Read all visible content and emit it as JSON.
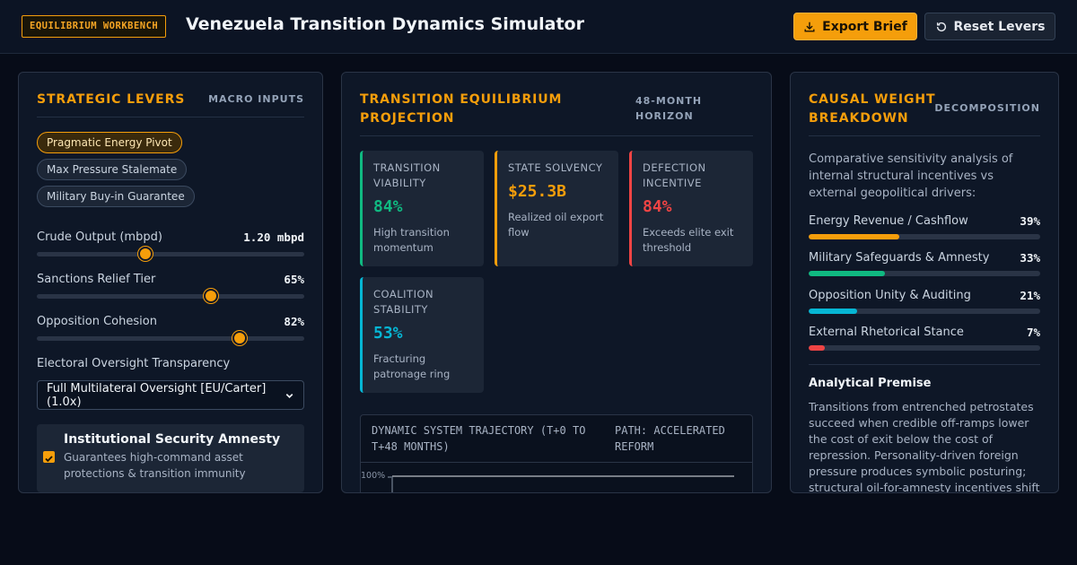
{
  "header": {
    "badge": "EQUILIBRIUM WORKBENCH",
    "title": "Venezuela Transition Dynamics Simulator",
    "export_label": "Export Brief",
    "reset_label": "Reset Levers"
  },
  "levers": {
    "title": "STRATEGIC LEVERS",
    "tag": "MACRO INPUTS",
    "scenarios": [
      {
        "label": "Pragmatic Energy Pivot",
        "active": true
      },
      {
        "label": "Max Pressure Stalemate",
        "active": false
      },
      {
        "label": "Military Buy-in Guarantee",
        "active": false
      }
    ],
    "sliders": [
      {
        "label": "Crude Output (mbpd)",
        "value": "1.20 mbpd",
        "level": 0.405
      },
      {
        "label": "Sanctions Relief Tier",
        "value": "65%",
        "level": 0.65
      },
      {
        "label": "Opposition Cohesion",
        "value": "82%",
        "level": 0.76
      }
    ],
    "oversight_label": "Electoral Oversight Transparency",
    "oversight_selected": "Full Multilateral Oversight [EU/Carter] (1.0x)",
    "amnesty": {
      "title": "Institutional Security Amnesty",
      "description": "Guarantees high-command asset protections & transition immunity",
      "checked": true
    }
  },
  "projection": {
    "title_line1": "TRANSITION EQUILIBRIUM",
    "title_line2": "PROJECTION",
    "tag_line1": "48-MONTH",
    "tag_line2": "HORIZON",
    "cards": [
      {
        "label": "TRANSITION VIABILITY",
        "value": "84%",
        "desc": "High transition momentum",
        "color": "#10b981"
      },
      {
        "label": "STATE SOLVENCY",
        "value": "$25.3B",
        "desc": "Realized oil export flow",
        "color": "#f59e0b"
      },
      {
        "label": "DEFECTION INCENTIVE",
        "value": "84%",
        "desc": "Exceeds elite exit threshold",
        "color": "#ef4444"
      },
      {
        "label": "COALITION STABILITY",
        "value": "53%",
        "desc": "Fracturing patronage ring",
        "color": "#06b6d4"
      }
    ],
    "trajectory": {
      "title": "DYNAMIC SYSTEM TRAJECTORY (T+0 TO T+48 MONTHS)",
      "path": "PATH: ACCELERATED REFORM",
      "y_top_label": "100%"
    }
  },
  "causal": {
    "title_line1": "CAUSAL WEIGHT",
    "title_line2": "BREAKDOWN",
    "tag": "DECOMPOSITION",
    "intro": "Comparative sensitivity analysis of internal structural incentives vs external geopolitical drivers:",
    "weights": [
      {
        "label": "Energy Revenue / Cashflow",
        "pct": "39%",
        "fraction": 0.39,
        "color": "#f59e0b"
      },
      {
        "label": "Military Safeguards & Amnesty",
        "pct": "33%",
        "fraction": 0.33,
        "color": "#10b981"
      },
      {
        "label": "Opposition Unity & Auditing",
        "pct": "21%",
        "fraction": 0.21,
        "color": "#06b6d4"
      },
      {
        "label": "External Rhetorical Stance",
        "pct": "7%",
        "fraction": 0.07,
        "color": "#ef4444"
      }
    ],
    "premise_title": "Analytical Premise",
    "premise": "Transitions from entrenched petrostates succeed when credible off-ramps lower the cost of exit below the cost of repression. Personality-driven foreign pressure produces symbolic posturing; structural oil-for-amnesty incentives shift"
  }
}
